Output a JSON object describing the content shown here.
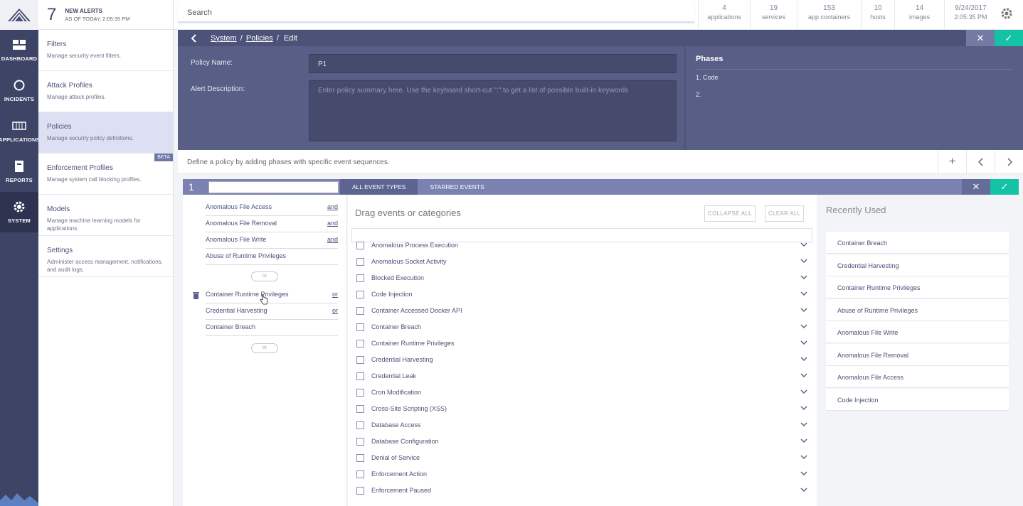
{
  "rail": {
    "items": [
      {
        "label": "DASHBOARD"
      },
      {
        "label": "INCIDENTS"
      },
      {
        "label": "APPLICATIONS"
      },
      {
        "label": "REPORTS"
      },
      {
        "label": "SYSTEM"
      }
    ]
  },
  "alerts": {
    "count": "7",
    "title": "NEW ALERTS",
    "subtitle": "AS OF TODAY, 2:05:35 PM"
  },
  "nav": [
    {
      "title": "Filters",
      "desc": "Manage security event filters."
    },
    {
      "title": "Attack Profiles",
      "desc": "Manage attack profiles."
    },
    {
      "title": "Policies",
      "desc": "Manage security policy definitions."
    },
    {
      "title": "Enforcement Profiles",
      "desc": "Manage system call blocking profiles.",
      "badge": "BETA"
    },
    {
      "title": "Models",
      "desc": "Manage machine learning models for applications."
    },
    {
      "title": "Settings",
      "desc": "Administer access management, notifications, and audit logs."
    }
  ],
  "topbar": {
    "search_label": "Search",
    "stats": [
      {
        "n": "4",
        "label": "applications"
      },
      {
        "n": "19",
        "label": "services"
      },
      {
        "n": "153",
        "label": "app containers"
      },
      {
        "n": "10",
        "label": "hosts"
      },
      {
        "n": "14",
        "label": "images"
      }
    ],
    "date": "9/24/2017",
    "time": "2:05:35 PM"
  },
  "editor": {
    "crumbs": {
      "system": "System",
      "policies": "Policies",
      "edit": "Edit",
      "sep": "/"
    },
    "policy_name_label": "Policy Name:",
    "policy_name_value": "P1",
    "alert_desc_label": "Alert Description:",
    "alert_desc_placeholder": "Enter policy summary here. Use the keyboard short-cut \":\" to get a list   of possible built-in keywords",
    "phases_title": "Phases",
    "phases": [
      "1. Code",
      "2."
    ]
  },
  "define_text": "Define a policy by adding phases with specific event sequences.",
  "phasebar": {
    "num": "1",
    "tab_all": "ALL EVENT TYPES",
    "tab_starred": "STARRED EVENTS"
  },
  "sequence": {
    "group1": [
      {
        "name": "Anomalous File Access",
        "op": "and"
      },
      {
        "name": "Anomalous File Removal",
        "op": "and"
      },
      {
        "name": "Anomalous File Write",
        "op": "and"
      },
      {
        "name": "Abuse of Runtime Privileges",
        "op": ""
      }
    ],
    "group2": [
      {
        "name": "Container Runtime Privileges",
        "op": "or"
      },
      {
        "name": "Credential Harvesting",
        "op": "or"
      },
      {
        "name": "Container Breach",
        "op": ""
      }
    ],
    "or_label": "or"
  },
  "events": {
    "title": "Drag events or categories",
    "collapse_all": "COLLAPSE ALL",
    "clear_all": "CLEAR ALL",
    "items": [
      "Anomalous Process Execution",
      "Anomalous Socket Activity",
      "Blocked Execution",
      "Code Injection",
      "Container Accessed Docker API",
      "Container Breach",
      "Container Runtime Privileges",
      "Credential Harvesting",
      "Credential Leak",
      "Cron Modification",
      "Cross-Site Scripting (XSS)",
      "Database Access",
      "Database Configuration",
      "Denial of Service",
      "Enforcement Action",
      "Enforcement Paused"
    ]
  },
  "recent": {
    "title": "Recently Used",
    "items": [
      "Container Breach",
      "Credential Harvesting",
      "Container Runtime Privileges",
      "Abuse of Runtime Privileges",
      "Anomalous File Write",
      "Anomalous File Removal",
      "Anomalous File Access",
      "Code Injection"
    ]
  },
  "colors": {
    "rail": "#3e4466",
    "accent": "#14c3a6",
    "header": "#585e85",
    "phasebar": "#7b82b2"
  }
}
